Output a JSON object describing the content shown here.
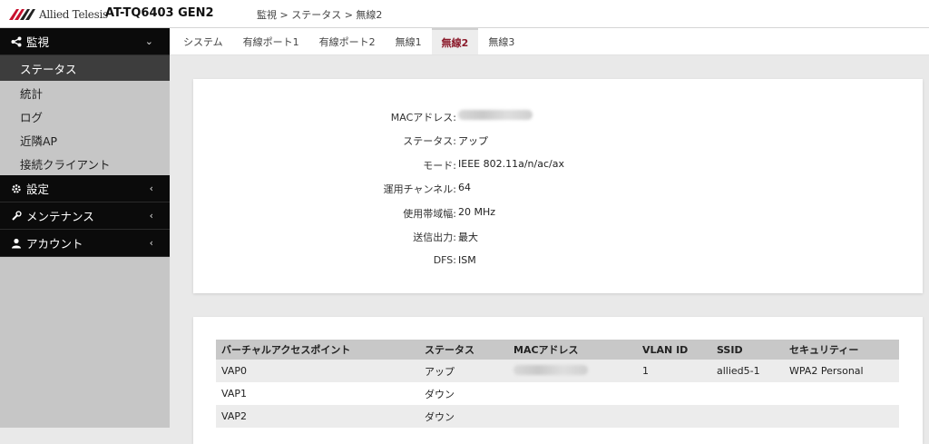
{
  "brand": {
    "logo_text": "Allied Telesis",
    "model": "AT-TQ6403 GEN2"
  },
  "breadcrumb": "監視 > ステータス > 無線2",
  "sidebar": {
    "monitor": {
      "label": "監視",
      "icon": "share-icon",
      "items": [
        "ステータス",
        "統計",
        "ログ",
        "近隣AP",
        "接続クライアント"
      ],
      "active": "ステータス"
    },
    "settings": {
      "label": "設定",
      "icon": "gear-icon"
    },
    "maintenance": {
      "label": "メンテナンス",
      "icon": "wrench-icon"
    },
    "account": {
      "label": "アカウント",
      "icon": "user-icon"
    }
  },
  "tabs": [
    "システム",
    "有線ポート1",
    "有線ポート2",
    "無線1",
    "無線2",
    "無線3"
  ],
  "active_tab": "無線2",
  "radio_status": {
    "rows": [
      {
        "label": "MACアドレス:",
        "value": ""
      },
      {
        "label": "ステータス:",
        "value": "アップ"
      },
      {
        "label": "モード:",
        "value": "IEEE 802.11a/n/ac/ax"
      },
      {
        "label": "運用チャンネル:",
        "value": "64"
      },
      {
        "label": "使用帯域幅:",
        "value": "20 MHz"
      },
      {
        "label": "送信出力:",
        "value": "最大"
      },
      {
        "label": "DFS:",
        "value": "ISM"
      }
    ]
  },
  "vap_table": {
    "headers": [
      "バーチャルアクセスポイント",
      "ステータス",
      "MACアドレス",
      "VLAN ID",
      "SSID",
      "セキュリティー"
    ],
    "rows": [
      [
        "VAP0",
        "アップ",
        "",
        "1",
        "allied5-1",
        "WPA2 Personal"
      ],
      [
        "VAP1",
        "ダウン",
        "",
        "",
        "",
        ""
      ],
      [
        "VAP2",
        "ダウン",
        "",
        "",
        "",
        ""
      ]
    ]
  },
  "colors": {
    "sidebar_dark": "#0b0b0b",
    "sidebar_active": "#3d3d3d",
    "tab_active_text": "#8b1a2b",
    "logo_red": "#c8102e"
  }
}
